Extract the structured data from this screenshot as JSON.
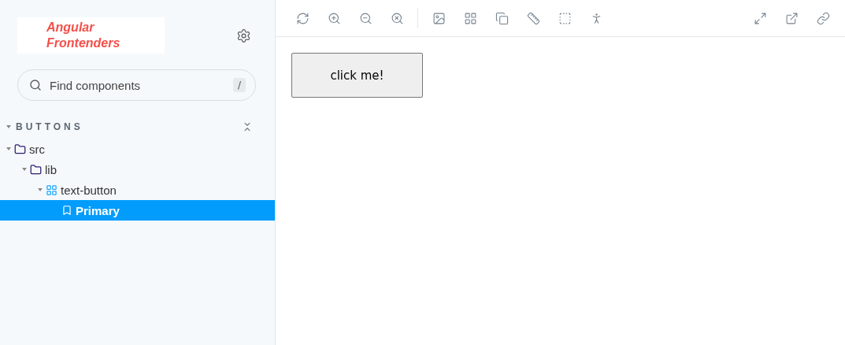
{
  "sidebar": {
    "logo": {
      "line_1": "Angular",
      "line_2": "Frontenders"
    },
    "search": {
      "placeholder": "Find components",
      "shortcut": "/"
    },
    "section": {
      "title": "BUTTONS",
      "expanded": true
    },
    "tree": [
      {
        "label": "src",
        "kind": "folder",
        "expanded": true,
        "selected": false,
        "children": [
          {
            "label": "lib",
            "kind": "folder",
            "expanded": true,
            "selected": false,
            "children": [
              {
                "label": "text-button",
                "kind": "component",
                "expanded": true,
                "selected": false,
                "children": [
                  {
                    "label": "Primary",
                    "kind": "story",
                    "selected": true
                  }
                ]
              }
            ]
          }
        ]
      }
    ]
  },
  "preview": {
    "button": "click me!"
  }
}
